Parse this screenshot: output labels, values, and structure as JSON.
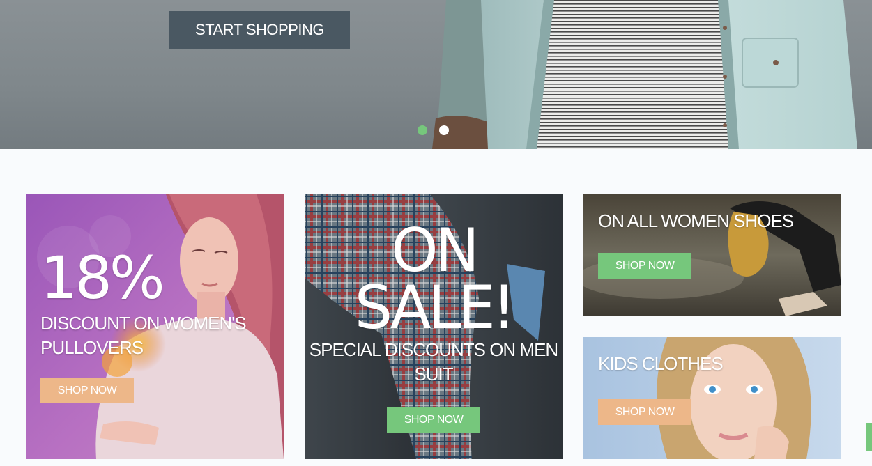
{
  "hero": {
    "cta_label": "START SHOPPING",
    "slides": [
      {
        "active": true
      },
      {
        "active": false
      }
    ]
  },
  "promos": {
    "women_pullovers": {
      "percent": "18%",
      "headline": "DISCOUNT ON WOMEN'S PULLOVERS",
      "button": "SHOP NOW"
    },
    "men_suit": {
      "line1": "ON",
      "line2": "SALE!",
      "headline": "SPECIAL DISCOUNTS ON MEN SUIT",
      "button": "SHOP NOW"
    },
    "women_shoes": {
      "headline": "ON ALL WOMEN SHOES",
      "button": "SHOP NOW"
    },
    "kids_clothes": {
      "headline": "KIDS CLOTHES",
      "button": "SHOP NOW"
    }
  },
  "colors": {
    "accent_green": "#76c77c",
    "accent_peach": "#edb789",
    "hero_button": "#4a5862",
    "page_background": "#f9fbfd"
  }
}
